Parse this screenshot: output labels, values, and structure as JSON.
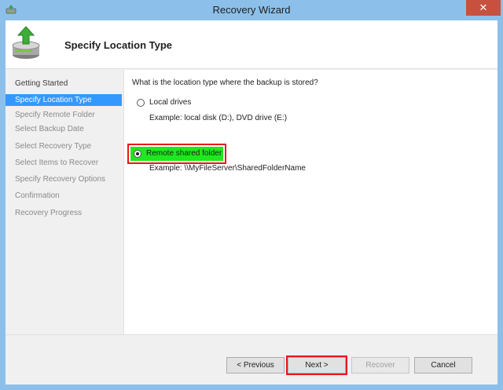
{
  "window": {
    "title": "Recovery Wizard",
    "close_glyph": "✕",
    "app_icon": "recovery-wizard-icon"
  },
  "header": {
    "title": "Specify Location Type",
    "icon": "backup-drive-recover-icon"
  },
  "steps": {
    "items": [
      {
        "label": "Getting Started",
        "state": "done"
      },
      {
        "label": "Specify Location Type",
        "state": "active"
      },
      {
        "label": "Specify Remote Folder",
        "state": "pending"
      },
      {
        "label": "Select Backup Date",
        "state": "pending"
      },
      {
        "label": "Select Recovery Type",
        "state": "pending"
      },
      {
        "label": "Select Items to Recover",
        "state": "pending"
      },
      {
        "label": "Specify Recovery Options",
        "state": "pending"
      },
      {
        "label": "Confirmation",
        "state": "pending"
      },
      {
        "label": "Recovery Progress",
        "state": "pending"
      }
    ]
  },
  "content": {
    "question": "What is the location type where the backup is stored?",
    "options": [
      {
        "label": "Local drives",
        "example": "Example: local disk (D:), DVD drive (E:)",
        "selected": false
      },
      {
        "label": "Remote shared folder",
        "example": "Example: \\\\MyFileServer\\SharedFolderName",
        "selected": true
      }
    ]
  },
  "footer": {
    "previous_label": "< Previous",
    "next_label": "Next >",
    "recover_label": "Recover",
    "cancel_label": "Cancel"
  },
  "colors": {
    "titlebar": "#8cc0ea",
    "close_button": "#c7503f",
    "active_step": "#3399ff",
    "highlight_border": "#e8161b",
    "highlight_fill": "#1ee81e"
  }
}
